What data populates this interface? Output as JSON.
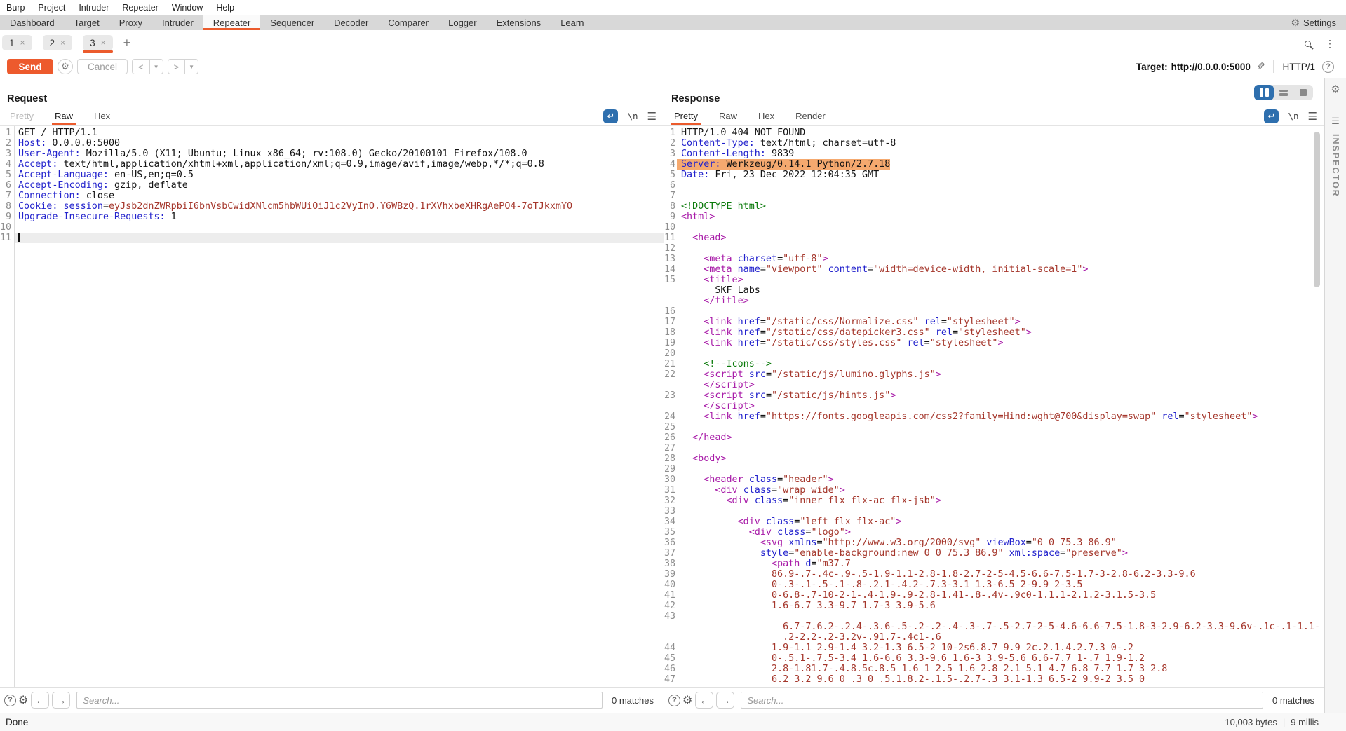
{
  "menubar": {
    "items": [
      "Burp",
      "Project",
      "Intruder",
      "Repeater",
      "Window",
      "Help"
    ]
  },
  "tabbar": {
    "tabs": [
      "Dashboard",
      "Target",
      "Proxy",
      "Intruder",
      "Repeater",
      "Sequencer",
      "Decoder",
      "Comparer",
      "Logger",
      "Extensions",
      "Learn"
    ],
    "selected": "Repeater",
    "settings_label": "Settings"
  },
  "subtabs": {
    "tabs": [
      "1",
      "2",
      "3"
    ],
    "selected": "3",
    "close_glyph": "×",
    "add_label": "+"
  },
  "toolbar": {
    "send_label": "Send",
    "cancel_label": "Cancel",
    "back_label": "<",
    "forward_label": ">",
    "target_label": "Target:",
    "target_url": "http://0.0.0.0:5000",
    "http_version": "HTTP/1"
  },
  "request": {
    "title": "Request",
    "tabs": [
      {
        "label": "Pretty",
        "state": "dis"
      },
      {
        "label": "Raw",
        "state": "sel"
      },
      {
        "label": "Hex",
        "state": "norm"
      }
    ],
    "newline_glyph": "\\n",
    "search_placeholder": "Search...",
    "matches": "0 matches",
    "rows": [
      {
        "n": "1",
        "seg": [
          [
            "k",
            "GET / HTTP/1.1"
          ]
        ]
      },
      {
        "n": "2",
        "seg": [
          [
            "b",
            "Host:"
          ],
          [
            "k",
            " 0.0.0.0:5000"
          ]
        ]
      },
      {
        "n": "3",
        "seg": [
          [
            "b",
            "User-Agent:"
          ],
          [
            "k",
            " Mozilla/5.0 (X11; Ubuntu; Linux x86_64; rv:108.0) Gecko/20100101 Firefox/108.0"
          ]
        ]
      },
      {
        "n": "4",
        "seg": [
          [
            "b",
            "Accept:"
          ],
          [
            "k",
            " text/html,application/xhtml+xml,application/xml;q=0.9,image/avif,image/webp,*/*;q=0.8"
          ]
        ]
      },
      {
        "n": "5",
        "seg": [
          [
            "b",
            "Accept-Language:"
          ],
          [
            "k",
            " en-US,en;q=0.5"
          ]
        ]
      },
      {
        "n": "6",
        "seg": [
          [
            "b",
            "Accept-Encoding:"
          ],
          [
            "k",
            " gzip, deflate"
          ]
        ]
      },
      {
        "n": "7",
        "seg": [
          [
            "b",
            "Connection:"
          ],
          [
            "k",
            " close"
          ]
        ]
      },
      {
        "n": "8",
        "seg": [
          [
            "b",
            "Cookie:"
          ],
          [
            "k",
            " "
          ],
          [
            "b",
            "session"
          ],
          [
            "k",
            "="
          ],
          [
            "r",
            "eyJsb2dnZWRpbiI6bnVsbCwidXNlcm5hbWUiOiJ1c2VyInO.Y6WBzQ.1rXVhxbeXHRgAePO4-7oTJkxmYO"
          ]
        ]
      },
      {
        "n": "9",
        "seg": [
          [
            "b",
            "Upgrade-Insecure-Requests:"
          ],
          [
            "k",
            " 1"
          ]
        ]
      },
      {
        "n": "10",
        "seg": []
      },
      {
        "n": "11",
        "seg": [],
        "cur": true
      }
    ]
  },
  "response": {
    "title": "Response",
    "tabs": [
      {
        "label": "Pretty",
        "state": "sel"
      },
      {
        "label": "Raw",
        "state": "norm"
      },
      {
        "label": "Hex",
        "state": "norm"
      },
      {
        "label": "Render",
        "state": "norm"
      }
    ],
    "newline_glyph": "\\n",
    "search_placeholder": "Search...",
    "matches": "0 matches",
    "rows": [
      {
        "n": "1",
        "seg": [
          [
            "k",
            "HTTP/1.0 404 NOT FOUND"
          ]
        ]
      },
      {
        "n": "2",
        "seg": [
          [
            "b",
            "Content-Type:"
          ],
          [
            "k",
            " text/html; charset=utf-8"
          ]
        ]
      },
      {
        "n": "3",
        "seg": [
          [
            "b",
            "Content-Length:"
          ],
          [
            "k",
            " 9839"
          ]
        ]
      },
      {
        "n": "4",
        "hl": true,
        "seg": [
          [
            "b",
            "Server:"
          ],
          [
            "k",
            " Werkzeug/0.14.1 Python/2.7.18"
          ]
        ]
      },
      {
        "n": "5",
        "seg": [
          [
            "b",
            "Date:"
          ],
          [
            "k",
            " Fri, 23 Dec 2022 12:04:35 GMT"
          ]
        ]
      },
      {
        "n": "6",
        "seg": []
      },
      {
        "n": "7",
        "seg": []
      },
      {
        "n": "8",
        "seg": [
          [
            "g",
            "<!DOCTYPE html>"
          ]
        ]
      },
      {
        "n": "9",
        "seg": [
          [
            "t",
            "<html>"
          ]
        ]
      },
      {
        "n": "10",
        "seg": []
      },
      {
        "n": "11",
        "seg": [
          [
            "k",
            "  "
          ],
          [
            "t",
            "<head>"
          ]
        ]
      },
      {
        "n": "12",
        "seg": []
      },
      {
        "n": "13",
        "seg": [
          [
            "k",
            "    "
          ],
          [
            "t",
            "<meta"
          ],
          [
            "k",
            " "
          ],
          [
            "b",
            "charset"
          ],
          [
            "k",
            "="
          ],
          [
            "r",
            "\"utf-8\""
          ],
          [
            "t",
            ">"
          ]
        ]
      },
      {
        "n": "14",
        "seg": [
          [
            "k",
            "    "
          ],
          [
            "t",
            "<meta"
          ],
          [
            "k",
            " "
          ],
          [
            "b",
            "name"
          ],
          [
            "k",
            "="
          ],
          [
            "r",
            "\"viewport\""
          ],
          [
            "k",
            " "
          ],
          [
            "b",
            "content"
          ],
          [
            "k",
            "="
          ],
          [
            "r",
            "\"width=device-width, initial-scale=1\""
          ],
          [
            "t",
            ">"
          ]
        ]
      },
      {
        "n": "15",
        "seg": [
          [
            "k",
            "    "
          ],
          [
            "t",
            "<title>"
          ]
        ]
      },
      {
        "n": "",
        "seg": [
          [
            "k",
            "      SKF Labs"
          ]
        ]
      },
      {
        "n": "",
        "seg": [
          [
            "k",
            "    "
          ],
          [
            "t",
            "</title>"
          ]
        ]
      },
      {
        "n": "16",
        "seg": []
      },
      {
        "n": "17",
        "seg": [
          [
            "k",
            "    "
          ],
          [
            "t",
            "<link"
          ],
          [
            "k",
            " "
          ],
          [
            "b",
            "href"
          ],
          [
            "k",
            "="
          ],
          [
            "r",
            "\"/static/css/Normalize.css\""
          ],
          [
            "k",
            " "
          ],
          [
            "b",
            "rel"
          ],
          [
            "k",
            "="
          ],
          [
            "r",
            "\"stylesheet\""
          ],
          [
            "t",
            ">"
          ]
        ]
      },
      {
        "n": "18",
        "seg": [
          [
            "k",
            "    "
          ],
          [
            "t",
            "<link"
          ],
          [
            "k",
            " "
          ],
          [
            "b",
            "href"
          ],
          [
            "k",
            "="
          ],
          [
            "r",
            "\"/static/css/datepicker3.css\""
          ],
          [
            "k",
            " "
          ],
          [
            "b",
            "rel"
          ],
          [
            "k",
            "="
          ],
          [
            "r",
            "\"stylesheet\""
          ],
          [
            "t",
            ">"
          ]
        ]
      },
      {
        "n": "19",
        "seg": [
          [
            "k",
            "    "
          ],
          [
            "t",
            "<link"
          ],
          [
            "k",
            " "
          ],
          [
            "b",
            "href"
          ],
          [
            "k",
            "="
          ],
          [
            "r",
            "\"/static/css/styles.css\""
          ],
          [
            "k",
            " "
          ],
          [
            "b",
            "rel"
          ],
          [
            "k",
            "="
          ],
          [
            "r",
            "\"stylesheet\""
          ],
          [
            "t",
            ">"
          ]
        ]
      },
      {
        "n": "20",
        "seg": []
      },
      {
        "n": "21",
        "seg": [
          [
            "k",
            "    "
          ],
          [
            "g",
            "<!--Icons-->"
          ]
        ]
      },
      {
        "n": "22",
        "seg": [
          [
            "k",
            "    "
          ],
          [
            "t",
            "<script"
          ],
          [
            "k",
            " "
          ],
          [
            "b",
            "src"
          ],
          [
            "k",
            "="
          ],
          [
            "r",
            "\"/static/js/lumino.glyphs.js\""
          ],
          [
            "t",
            ">"
          ]
        ]
      },
      {
        "n": "",
        "seg": [
          [
            "k",
            "    "
          ],
          [
            "t",
            "</script>"
          ]
        ]
      },
      {
        "n": "23",
        "seg": [
          [
            "k",
            "    "
          ],
          [
            "t",
            "<script"
          ],
          [
            "k",
            " "
          ],
          [
            "b",
            "src"
          ],
          [
            "k",
            "="
          ],
          [
            "r",
            "\"/static/js/hints.js\""
          ],
          [
            "t",
            ">"
          ]
        ]
      },
      {
        "n": "",
        "seg": [
          [
            "k",
            "    "
          ],
          [
            "t",
            "</script>"
          ]
        ]
      },
      {
        "n": "24",
        "seg": [
          [
            "k",
            "    "
          ],
          [
            "t",
            "<link"
          ],
          [
            "k",
            " "
          ],
          [
            "b",
            "href"
          ],
          [
            "k",
            "="
          ],
          [
            "r",
            "\"https://fonts.googleapis.com/css2?family=Hind:wght@700&display=swap\""
          ],
          [
            "k",
            " "
          ],
          [
            "b",
            "rel"
          ],
          [
            "k",
            "="
          ],
          [
            "r",
            "\"stylesheet\""
          ],
          [
            "t",
            ">"
          ]
        ]
      },
      {
        "n": "25",
        "seg": []
      },
      {
        "n": "26",
        "seg": [
          [
            "k",
            "  "
          ],
          [
            "t",
            "</head>"
          ]
        ]
      },
      {
        "n": "27",
        "seg": []
      },
      {
        "n": "28",
        "seg": [
          [
            "k",
            "  "
          ],
          [
            "t",
            "<body>"
          ]
        ]
      },
      {
        "n": "29",
        "seg": []
      },
      {
        "n": "30",
        "seg": [
          [
            "k",
            "    "
          ],
          [
            "t",
            "<header"
          ],
          [
            "k",
            " "
          ],
          [
            "b",
            "class"
          ],
          [
            "k",
            "="
          ],
          [
            "r",
            "\"header\""
          ],
          [
            "t",
            ">"
          ]
        ]
      },
      {
        "n": "31",
        "seg": [
          [
            "k",
            "      "
          ],
          [
            "t",
            "<div"
          ],
          [
            "k",
            " "
          ],
          [
            "b",
            "class"
          ],
          [
            "k",
            "="
          ],
          [
            "r",
            "\"wrap wide\""
          ],
          [
            "t",
            ">"
          ]
        ]
      },
      {
        "n": "32",
        "seg": [
          [
            "k",
            "        "
          ],
          [
            "t",
            "<div"
          ],
          [
            "k",
            " "
          ],
          [
            "b",
            "class"
          ],
          [
            "k",
            "="
          ],
          [
            "r",
            "\"inner flx flx-ac flx-jsb\""
          ],
          [
            "t",
            ">"
          ]
        ]
      },
      {
        "n": "33",
        "seg": []
      },
      {
        "n": "34",
        "seg": [
          [
            "k",
            "          "
          ],
          [
            "t",
            "<div"
          ],
          [
            "k",
            " "
          ],
          [
            "b",
            "class"
          ],
          [
            "k",
            "="
          ],
          [
            "r",
            "\"left flx flx-ac\""
          ],
          [
            "t",
            ">"
          ]
        ]
      },
      {
        "n": "35",
        "seg": [
          [
            "k",
            "            "
          ],
          [
            "t",
            "<div"
          ],
          [
            "k",
            " "
          ],
          [
            "b",
            "class"
          ],
          [
            "k",
            "="
          ],
          [
            "r",
            "\"logo\""
          ],
          [
            "t",
            ">"
          ]
        ]
      },
      {
        "n": "36",
        "seg": [
          [
            "k",
            "              "
          ],
          [
            "t",
            "<svg"
          ],
          [
            "k",
            " "
          ],
          [
            "b",
            "xmlns"
          ],
          [
            "k",
            "="
          ],
          [
            "r",
            "\"http://www.w3.org/2000/svg\""
          ],
          [
            "k",
            " "
          ],
          [
            "b",
            "viewBox"
          ],
          [
            "k",
            "="
          ],
          [
            "r",
            "\"0 0 75.3 86.9\""
          ]
        ]
      },
      {
        "n": "37",
        "seg": [
          [
            "k",
            "              "
          ],
          [
            "b",
            "style"
          ],
          [
            "k",
            "="
          ],
          [
            "r",
            "\"enable-background:new 0 0 75.3 86.9\""
          ],
          [
            "k",
            " "
          ],
          [
            "b",
            "xml:space"
          ],
          [
            "k",
            "="
          ],
          [
            "r",
            "\"preserve\""
          ],
          [
            "t",
            ">"
          ]
        ]
      },
      {
        "n": "38",
        "seg": [
          [
            "k",
            "                "
          ],
          [
            "t",
            "<path"
          ],
          [
            "k",
            " "
          ],
          [
            "b",
            "d"
          ],
          [
            "k",
            "="
          ],
          [
            "r",
            "\"m37.7"
          ]
        ]
      },
      {
        "n": "39",
        "seg": [
          [
            "k",
            "                "
          ],
          [
            "r",
            "86.9-.7-.4c-.9-.5-1.9-1.1-2.8-1.8-2.7-2-5-4.5-6.6-7.5-1.7-3-2.8-6.2-3.3-9.6"
          ]
        ]
      },
      {
        "n": "40",
        "seg": [
          [
            "k",
            "                "
          ],
          [
            "r",
            "0-.3-.1-.5-.1-.8-.2.1-.4.2-.7.3-3.1 1.3-6.5 2-9.9 2-3.5"
          ]
        ]
      },
      {
        "n": "41",
        "seg": [
          [
            "k",
            "                "
          ],
          [
            "r",
            "0-6.8-.7-10-2-1-.4-1.9-.9-2.8-1.41-.8-.4v-.9c0-1.1.1-2.1.2-3.1.5-3.5"
          ]
        ]
      },
      {
        "n": "42",
        "seg": [
          [
            "k",
            "                "
          ],
          [
            "r",
            "1.6-6.7 3.3-9.7 1.7-3 3.9-5.6"
          ]
        ]
      },
      {
        "n": "43",
        "seg": []
      },
      {
        "n": "",
        "seg": [
          [
            "k",
            "                  "
          ],
          [
            "r",
            "6.7-7.6.2-.2.4-.3.6-.5-.2-.2-.4-.3-.7-.5-2.7-2-5-4.6-6.6-7.5-1.8-3-2.9-6.2-3.3-9.6v-.1c-.1-1.1-"
          ]
        ]
      },
      {
        "n": "",
        "seg": [
          [
            "k",
            "                  "
          ],
          [
            "r",
            ".2-2.2-.2-3.2v-.91.7-.4c1-.6"
          ]
        ]
      },
      {
        "n": "44",
        "seg": [
          [
            "k",
            "                "
          ],
          [
            "r",
            "1.9-1.1 2.9-1.4 3.2-1.3 6.5-2 10-2s6.8.7 9.9 2c.2.1.4.2.7.3 0-.2"
          ]
        ]
      },
      {
        "n": "45",
        "seg": [
          [
            "k",
            "                "
          ],
          [
            "r",
            "0-.5.1-.7.5-3.4 1.6-6.6 3.3-9.6 1.6-3 3.9-5.6 6.6-7.7 1-.7 1.9-1.2"
          ]
        ]
      },
      {
        "n": "46",
        "seg": [
          [
            "k",
            "                "
          ],
          [
            "r",
            "2.8-1.81.7-.4.8.5c.8.5 1.6 1 2.5 1.6 2.8 2.1 5.1 4.7 6.8 7.7 1.7 3 2.8"
          ]
        ]
      },
      {
        "n": "47",
        "seg": [
          [
            "k",
            "                "
          ],
          [
            "r",
            "6.2 3.2 9.6 0 .3 0 .5.1.8.2-.1.5-.2.7-.3 3.1-1.3 6.5-2 9.9-2 3.5 0"
          ]
        ]
      }
    ]
  },
  "inspector": {
    "label": "INSPECTOR"
  },
  "statusbar": {
    "status": "Done",
    "bytes": "10,003 bytes",
    "time": "9 millis"
  },
  "colors": {
    "accent_orange": "#eb5b2d",
    "highlight": "#f5a96f",
    "header_blue": "#2323cd",
    "value_red": "#a5372c",
    "tag_purple": "#a81ba8",
    "comment_green": "#0a7a0a",
    "wrap_icon_blue": "#2e6fae"
  }
}
